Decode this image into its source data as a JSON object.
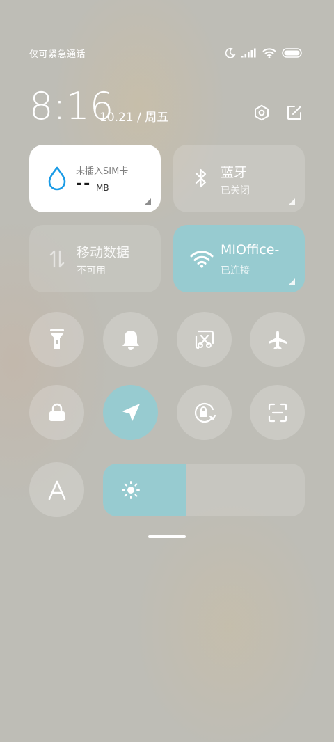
{
  "status_bar": {
    "carrier": "仅可紧急通话",
    "icons": [
      "moon-icon",
      "signal-icon",
      "wifi-icon",
      "battery-icon"
    ]
  },
  "header": {
    "time": "8:16",
    "date": "10.21 / 周五",
    "actions": [
      "settings-icon",
      "edit-icon"
    ]
  },
  "cards": {
    "data_usage": {
      "label": "未插入SIM卡",
      "value": "--",
      "unit": "MB",
      "icon": "water-drop-icon"
    },
    "bluetooth": {
      "title": "蓝牙",
      "status": "已关闭",
      "icon": "bluetooth-icon"
    },
    "mobile_data": {
      "title": "移动数据",
      "status": "不可用",
      "icon": "mobile-data-icon"
    },
    "wifi": {
      "title": "MIOffice-",
      "status": "已连接",
      "icon": "wifi-icon"
    }
  },
  "toggles": [
    {
      "name": "flashlight",
      "icon": "flashlight-icon",
      "active": false
    },
    {
      "name": "mute",
      "icon": "bell-icon",
      "active": false
    },
    {
      "name": "screenshot",
      "icon": "screenshot-scissors-icon",
      "active": false
    },
    {
      "name": "airplane-mode",
      "icon": "airplane-icon",
      "active": false
    },
    {
      "name": "lock-screen",
      "icon": "lock-icon",
      "active": false
    },
    {
      "name": "location",
      "icon": "location-arrow-icon",
      "active": true
    },
    {
      "name": "rotation-lock",
      "icon": "rotation-lock-icon",
      "active": false
    },
    {
      "name": "scanner",
      "icon": "scan-icon",
      "active": false
    },
    {
      "name": "auto-brightness",
      "icon": "letter-a-icon",
      "active": false
    }
  ],
  "brightness": {
    "level": 0.41,
    "icon": "sun-icon"
  },
  "colors": {
    "accent": "#97cbd0",
    "background": "#bebdb6",
    "card_white": "#ffffff",
    "drop_blue": "#1a9be6"
  }
}
